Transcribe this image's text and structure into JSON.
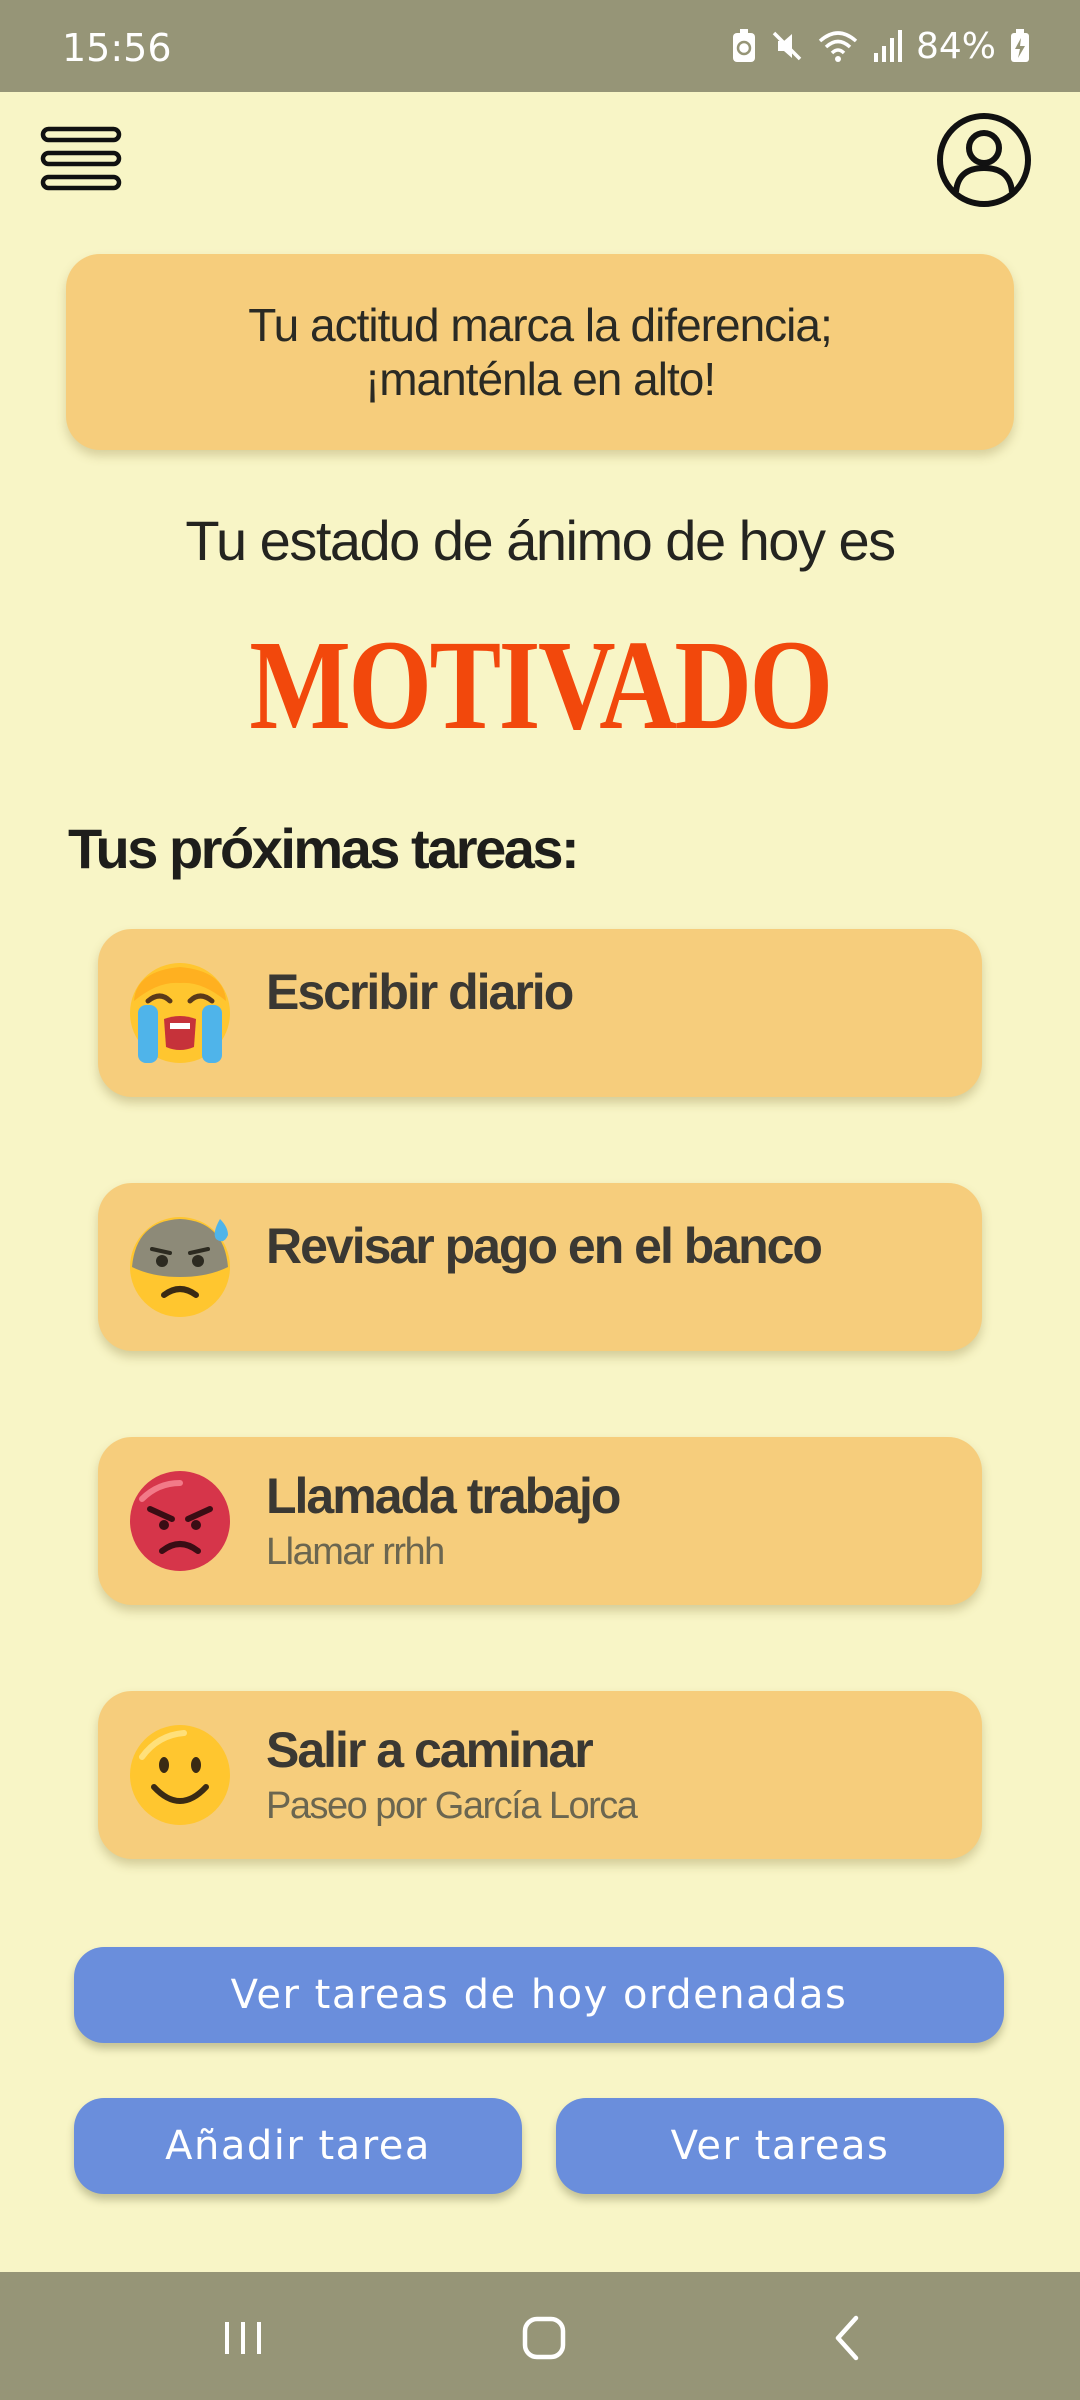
{
  "status_bar": {
    "time": "15:56",
    "battery": "84%",
    "icons": [
      "battery-saver-icon",
      "mute-icon",
      "wifi-icon",
      "signal-icon",
      "battery-charging-icon"
    ]
  },
  "header": {
    "menu_icon": "hamburger-menu-icon",
    "profile_icon": "user-profile-icon"
  },
  "quote": "Tu actitud marca la diferencia; ¡manténla en alto!",
  "mood": {
    "intro": "Tu estado de ánimo de hoy es",
    "value": "MOTIVADO"
  },
  "tasks_heading": "Tus próximas tareas:",
  "tasks": [
    {
      "title": "Escribir diario",
      "subtitle": "",
      "emoji": "crying-face-icon"
    },
    {
      "title": "Revisar pago en el banco",
      "subtitle": "",
      "emoji": "anxious-sweat-face-icon"
    },
    {
      "title": "Llamada trabajo",
      "subtitle": "Llamar rrhh",
      "emoji": "angry-face-icon"
    },
    {
      "title": "Salir a caminar",
      "subtitle": "Paseo por García Lorca",
      "emoji": "smiling-face-icon"
    }
  ],
  "buttons": {
    "sorted_today": "Ver tareas de hoy ordenadas",
    "add_task": "Añadir tarea",
    "view_tasks": "Ver tareas"
  },
  "nav": {
    "recents_icon": "recents-icon",
    "home_icon": "home-icon",
    "back_icon": "back-icon"
  },
  "colors": {
    "background": "#f8f5c6",
    "card": "#f6cd7c",
    "accent": "#f2480c",
    "button": "#6a8edc",
    "system_bars": "#969577"
  }
}
